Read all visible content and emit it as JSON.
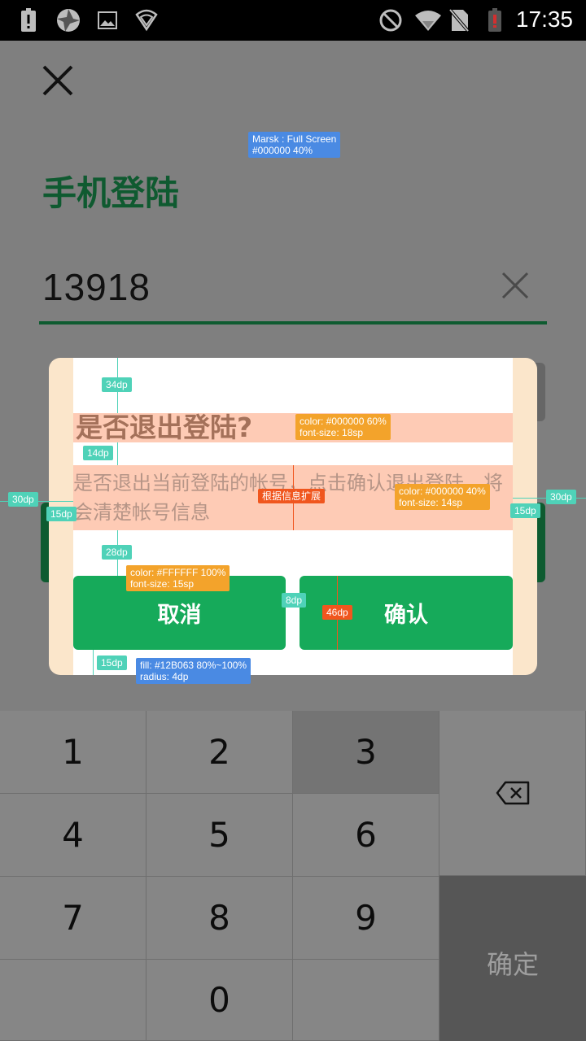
{
  "status_bar": {
    "time": "17:35",
    "icons": [
      "alert-icon",
      "aperture-icon",
      "image-icon",
      "shield-wifi-icon",
      "do-not-disturb-icon",
      "wifi-icon",
      "no-sim-icon",
      "battery-low-icon"
    ]
  },
  "page": {
    "title": "手机登陆",
    "phone_value": "13918",
    "close_icon": "close-icon",
    "clear_icon": "clear-icon"
  },
  "annotations": {
    "mask": "Marsk : Full Screen\n#000000 40%",
    "title_spec": "color: #000000 60%\nfont-size: 18sp",
    "msg_spec": "color: #000000 40%\nfont-size: 14sp",
    "expand": "根据信息扩展",
    "button_text_spec": "color: #FFFFFF 100%\nfont-size: 15sp",
    "button_fill_spec": "fill: #12B063 80%~100%\nradius: 4dp",
    "gap_34": "34dp",
    "gap_14": "14dp",
    "gap_28": "28dp",
    "gap_8": "8dp",
    "height_46": "46dp",
    "margin_15_left": "15dp",
    "margin_15_right": "15dp",
    "margin_15_bottom": "15dp",
    "margin_30_left": "30dp",
    "margin_30_right": "30dp"
  },
  "dialog": {
    "title": "是否退出登陆?",
    "message": "是否退出当前登陆的帐号，点击确认退出登陆，将会清楚帐号信息",
    "cancel_label": "取消",
    "confirm_label": "确认"
  },
  "keypad": {
    "keys": [
      "1",
      "2",
      "3",
      "4",
      "5",
      "6",
      "7",
      "8",
      "9",
      "0"
    ],
    "delete_icon": "backspace-icon",
    "ok_label": "确定"
  },
  "colors": {
    "brand_green": "#16aa5a",
    "title_green": "#0f5a30",
    "annotation_blue": "#4a8ae3",
    "annotation_teal": "#4fd2b8",
    "annotation_orange": "#f3a32b"
  }
}
